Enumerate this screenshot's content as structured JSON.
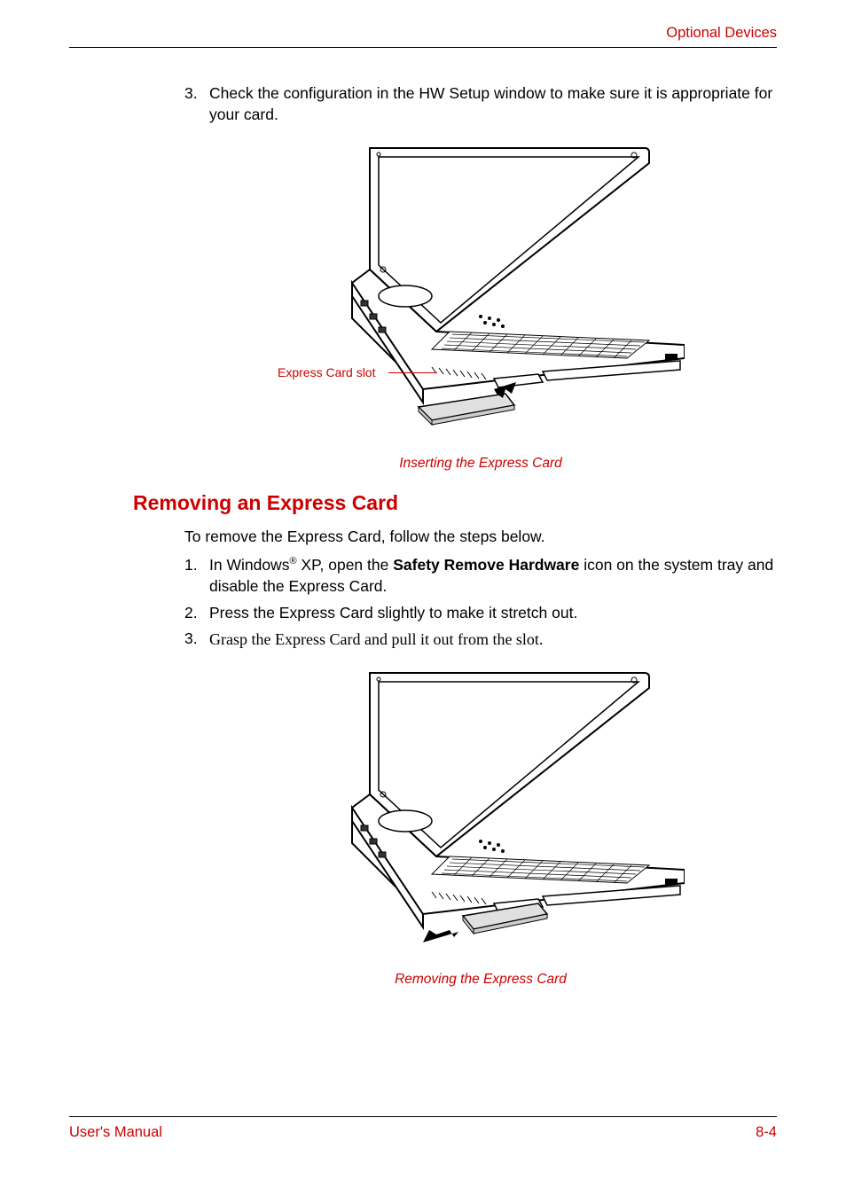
{
  "header": {
    "section_title": "Optional Devices"
  },
  "step3": {
    "number": "3.",
    "text": "Check the configuration in the HW Setup window to make sure it is appropriate for your card."
  },
  "figure1": {
    "callout": "Express Card slot",
    "caption": "Inserting the Express Card"
  },
  "heading": "Removing an Express Card",
  "intro": "To remove the Express Card, follow the steps below.",
  "removal_steps": [
    {
      "number": "1.",
      "prefix": "In Windows",
      "reg": "®",
      "mid": " XP, open the ",
      "bold": "Safety Remove Hardware",
      "suffix": " icon on the system tray and disable the Express Card."
    },
    {
      "number": "2.",
      "text": "Press the Express Card slightly to make it stretch out."
    },
    {
      "number": "3.",
      "text": "Grasp the Express Card and pull it out from the slot."
    }
  ],
  "figure2": {
    "caption": "Removing the Express Card"
  },
  "footer": {
    "left": "User's Manual",
    "right": "8-4"
  }
}
